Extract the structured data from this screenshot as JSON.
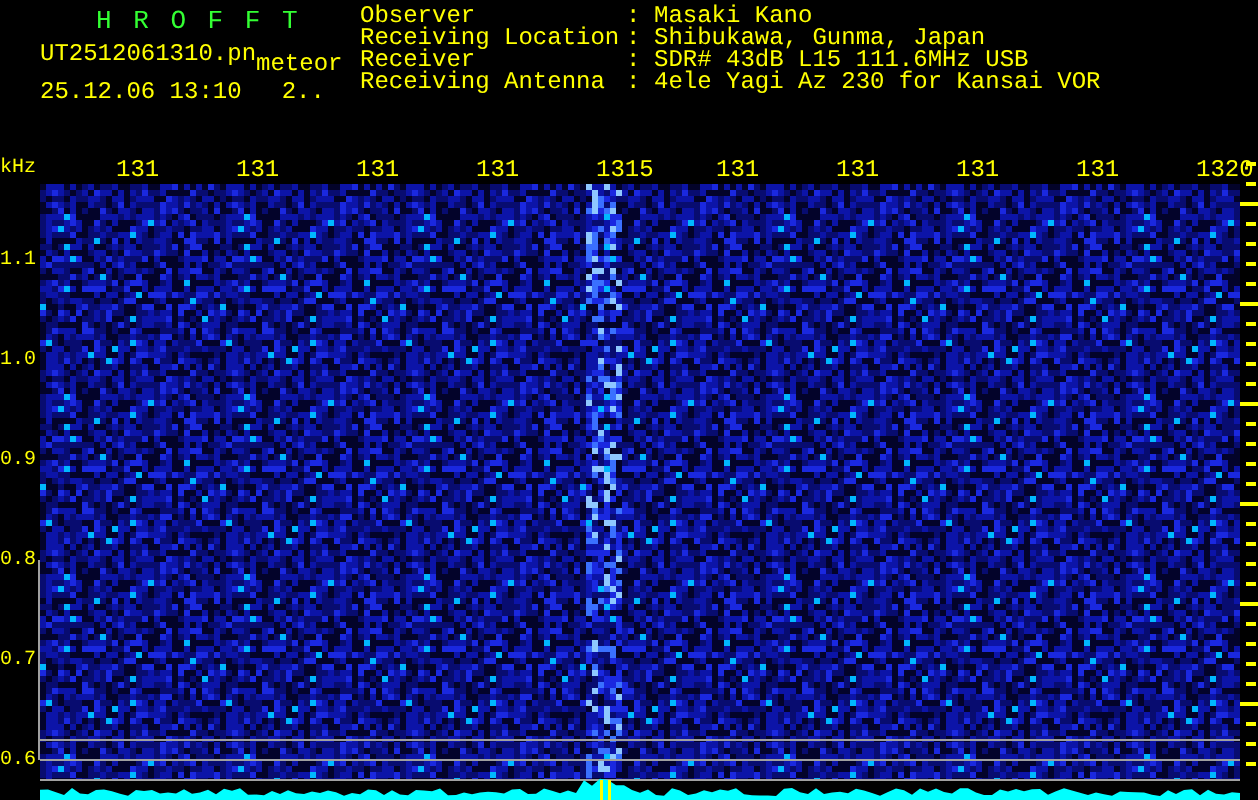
{
  "app_title": "H R O F F T",
  "file_name": "UT2512061310.pn",
  "event_type": "meteor",
  "datetime": "25.12.06 13:10",
  "count": "2..",
  "info": [
    {
      "label": "Observer",
      "separator": ":",
      "value": "Masaki Kano"
    },
    {
      "label": "Receiving Location",
      "separator": ":",
      "value": "Shibukawa, Gunma, Japan"
    },
    {
      "label": "Receiver",
      "separator": ":",
      "value": "SDR# 43dB L15 111.6MHz USB"
    },
    {
      "label": "Receiving Antenna",
      "separator": ":",
      "value": "4ele Yagi Az 230 for Kansai VOR"
    }
  ],
  "x_axis_labels": [
    "131",
    "131",
    "131",
    "131",
    "1315",
    "131",
    "131",
    "131",
    "131",
    "1320"
  ],
  "y_axis": {
    "unit": "kHz",
    "labels": [
      "1.1",
      "1.0",
      "0.9",
      "0.8",
      "0.7",
      "0.6"
    ]
  }
}
